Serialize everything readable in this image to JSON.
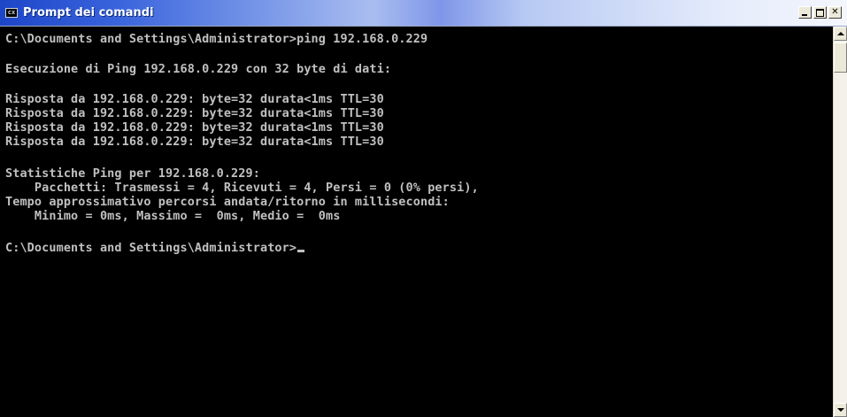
{
  "window": {
    "title": "Prompt dei comandi",
    "icon": "cmd-icon",
    "icon_glyph": "cx",
    "controls": {
      "minimize": "minimize-icon",
      "maximize": "maximize-icon",
      "close_glyph": "✕"
    }
  },
  "console": {
    "lines": [
      "C:\\Documents and Settings\\Administrator>ping 192.168.0.229",
      "Esecuzione di Ping 192.168.0.229 con 32 byte di dati:",
      "Risposta da 192.168.0.229: byte=32 durata<1ms TTL=30",
      "Risposta da 192.168.0.229: byte=32 durata<1ms TTL=30",
      "Risposta da 192.168.0.229: byte=32 durata<1ms TTL=30",
      "Risposta da 192.168.0.229: byte=32 durata<1ms TTL=30",
      "Statistiche Ping per 192.168.0.229:",
      "    Pacchetti: Trasmessi = 4, Ricevuti = 4, Persi = 0 (0% persi),",
      "Tempo approssimativo percorsi andata/ritorno in millisecondi:",
      "    Minimo = 0ms, Massimo =  0ms, Medio =  0ms",
      "C:\\Documents and Settings\\Administrator>"
    ]
  },
  "colors": {
    "console_background": "#000000",
    "console_text": "#c0c0c0",
    "titlebar_start": "#1c46c8"
  }
}
